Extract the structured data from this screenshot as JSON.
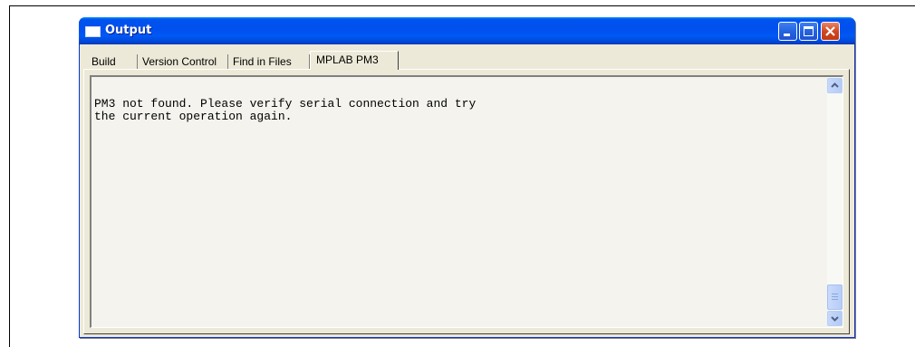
{
  "window": {
    "title": "Output"
  },
  "tabs": [
    {
      "label": "Build"
    },
    {
      "label": "Version Control"
    },
    {
      "label": "Find in Files"
    },
    {
      "label": "MPLAB PM3",
      "active": true
    }
  ],
  "output": {
    "line1": "PM3 not found. Please verify serial connection and try",
    "line2": "the current operation again."
  },
  "colors": {
    "titlebar": "#0054e3",
    "close_button": "#d2471f",
    "panel_bg": "#ece9d8"
  },
  "icons": [
    "window-icon",
    "minimize-icon",
    "maximize-icon",
    "close-icon",
    "scroll-up-icon",
    "scroll-down-icon"
  ]
}
